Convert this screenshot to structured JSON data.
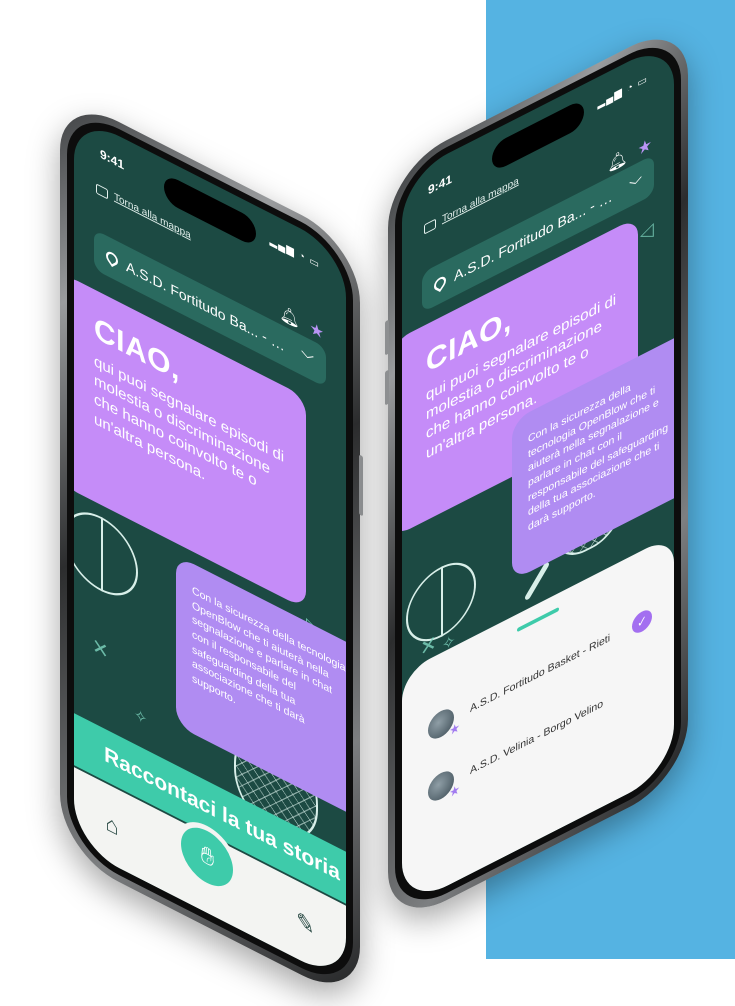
{
  "status": {
    "time": "9:41"
  },
  "nav": {
    "back_label": "Torna alla mappa"
  },
  "club_select": {
    "value": "A.S.D. Fortitudo Ba... - Rieti"
  },
  "welcome": {
    "heading": "CIAO,",
    "message": "qui puoi segnalare episodi di molestia o discriminazione che hanno coinvolto te o un'altra persona.",
    "info": "Con la sicurezza della tecnologia OpenBlow che ti aiuterà nella segnalazione e parlare in chat con il responsabile del safeguarding della tua associazione che ti darà supporto."
  },
  "cta": {
    "label": "Raccontaci la tua storia"
  },
  "clubs": [
    {
      "name": "A.S.D. Fortitudo Basket - Rieti",
      "selected": true
    },
    {
      "name": "A.S.D. Velinia - Borgo Velino",
      "selected": false
    }
  ],
  "colors": {
    "background": "#1c4a43",
    "purple_bubble": "#c58cf8",
    "lilac_bubble": "#b08cf2",
    "accent_green": "#3ecbaa",
    "side_panel": "#55b3e2"
  },
  "icons": [
    "map-icon",
    "bell-icon",
    "star-icon",
    "pin-icon",
    "chevron-down-icon",
    "home-icon",
    "hand-icon",
    "report-icon",
    "check-icon"
  ]
}
